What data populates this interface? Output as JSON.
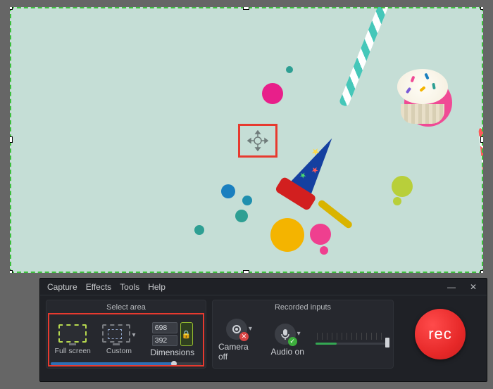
{
  "menu": {
    "capture": "Capture",
    "effects": "Effects",
    "tools": "Tools",
    "help": "Help"
  },
  "window": {
    "minimize": "—",
    "close": "✕"
  },
  "panels": {
    "select_area_title": "Select area",
    "recorded_inputs_title": "Recorded inputs"
  },
  "select_area": {
    "full_screen_label": "Full screen",
    "custom_label": "Custom",
    "dimensions_label": "Dimensions",
    "width": "698",
    "height": "392"
  },
  "recorded_inputs": {
    "camera_label": "Camera off",
    "audio_label": "Audio on"
  },
  "record": {
    "label": "rec"
  }
}
